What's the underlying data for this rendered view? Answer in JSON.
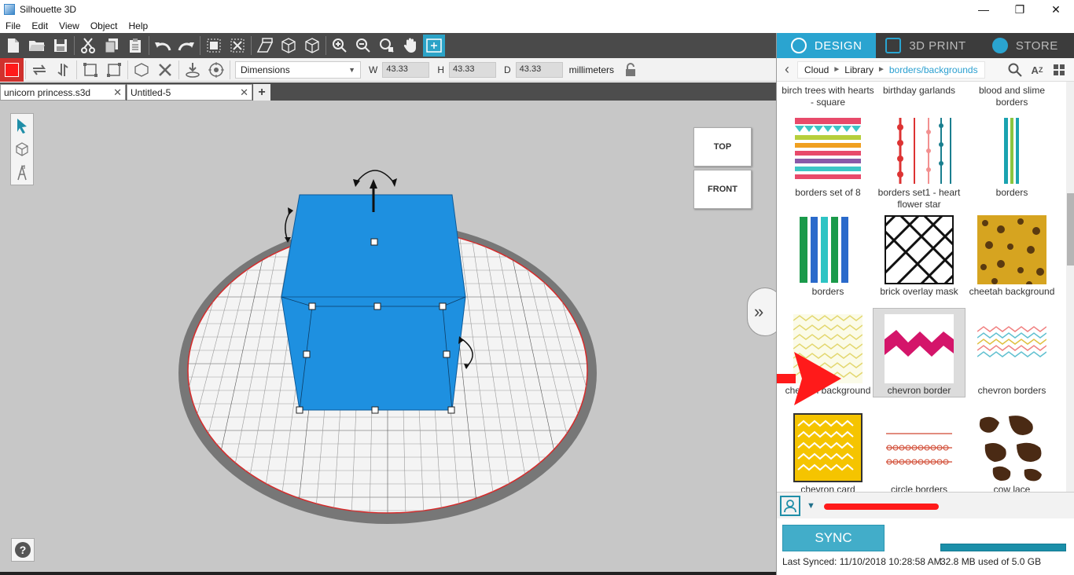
{
  "window": {
    "title": "Silhouette 3D",
    "minimize": "—",
    "maximize": "❐",
    "close": "✕"
  },
  "menu": [
    "File",
    "Edit",
    "View",
    "Object",
    "Help"
  ],
  "toolbar2": {
    "dimension_mode": "Dimensions",
    "w_label": "W",
    "w_value": "43.33",
    "h_label": "H",
    "h_value": "43.33",
    "d_label": "D",
    "d_value": "43.33",
    "unit": "millimeters"
  },
  "doc_tabs": [
    {
      "label": "unicorn princess.s3d",
      "close": "✕"
    },
    {
      "label": "Untitled-5",
      "close": "✕"
    }
  ],
  "add_tab": "+",
  "viewcube": {
    "top": "TOP",
    "front": "FRONT"
  },
  "help": "?",
  "expand": "»",
  "mode_tabs": [
    {
      "label": "DESIGN",
      "active": true
    },
    {
      "label": "3D PRINT",
      "active": false
    },
    {
      "label": "STORE",
      "active": false
    }
  ],
  "breadcrumbs": [
    "Cloud",
    "Library",
    "borders/backgrounds"
  ],
  "library_items": [
    {
      "label": "birch trees with hearts - square",
      "row": 0,
      "col": 0
    },
    {
      "label": "birthday garlands",
      "row": 0,
      "col": 1
    },
    {
      "label": "blood and slime borders",
      "row": 0,
      "col": 2
    },
    {
      "label": "borders set of 8",
      "row": 1,
      "col": 0
    },
    {
      "label": "borders set1 - heart flower star",
      "row": 1,
      "col": 1
    },
    {
      "label": "borders",
      "row": 1,
      "col": 2
    },
    {
      "label": "borders",
      "row": 2,
      "col": 0
    },
    {
      "label": "brick overlay mask",
      "row": 2,
      "col": 1
    },
    {
      "label": "cheetah background",
      "row": 2,
      "col": 2
    },
    {
      "label": "chevron background",
      "row": 3,
      "col": 0
    },
    {
      "label": "chevron border",
      "row": 3,
      "col": 1,
      "selected": true
    },
    {
      "label": "chevron borders",
      "row": 3,
      "col": 2
    },
    {
      "label": "chevron card",
      "row": 4,
      "col": 0
    },
    {
      "label": "circle borders",
      "row": 4,
      "col": 1
    },
    {
      "label": "cow lace",
      "row": 4,
      "col": 2
    }
  ],
  "sync": {
    "button": "SYNC",
    "last_synced": "Last Synced: 11/10/2018 10:28:58 AM",
    "storage": "32.8 MB used of 5.0 GB",
    "storage_used_fraction": 0.0064
  },
  "colors": {
    "accent": "#2aa4d0",
    "object_blue": "#1e90e0",
    "annotation_red": "#ff1a1a"
  }
}
